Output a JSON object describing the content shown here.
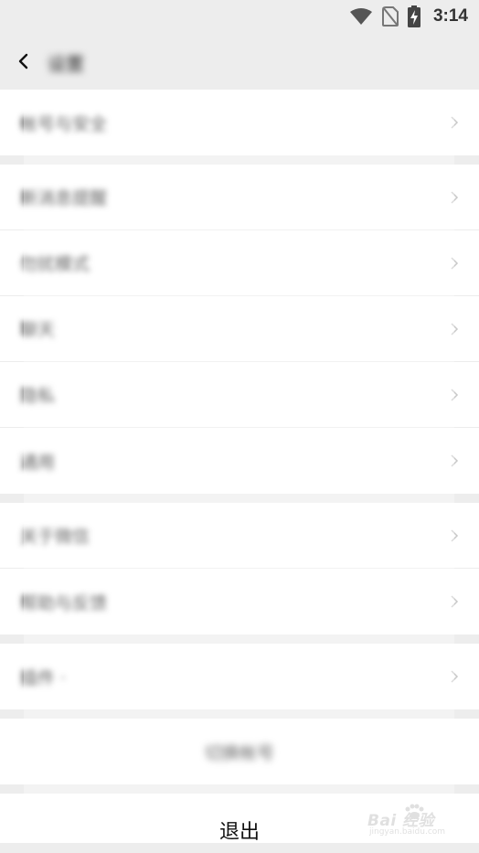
{
  "status_bar": {
    "time": "3:14",
    "icons": [
      "wifi-icon",
      "no-sim-icon",
      "battery-charging-icon"
    ]
  },
  "header": {
    "back_icon": "chevron-left-icon",
    "title": "设置"
  },
  "groups": [
    {
      "items": [
        {
          "name": "account-security",
          "label": "帐号与安全"
        }
      ]
    },
    {
      "items": [
        {
          "name": "new-message-notify",
          "label": "新消息提醒"
        },
        {
          "name": "do-not-disturb",
          "label": "勿扰模式"
        },
        {
          "name": "chat",
          "label": "聊天"
        },
        {
          "name": "privacy",
          "label": "隐私"
        },
        {
          "name": "general",
          "label": "通用"
        }
      ]
    },
    {
      "items": [
        {
          "name": "about",
          "label": "关于微信"
        },
        {
          "name": "help-feedback",
          "label": "帮助与反馈"
        }
      ]
    },
    {
      "items": [
        {
          "name": "plugins",
          "label": "插件 ·"
        }
      ]
    }
  ],
  "switch_account": {
    "label": "切换帐号"
  },
  "logout": {
    "label": "退出"
  },
  "watermark": {
    "brand": "Bai 经验",
    "sub": "jingyan.baidu.com"
  },
  "colors": {
    "background": "#ededed",
    "row": "#ffffff",
    "divider": "#ececec",
    "chevron": "#c8c8c8"
  }
}
